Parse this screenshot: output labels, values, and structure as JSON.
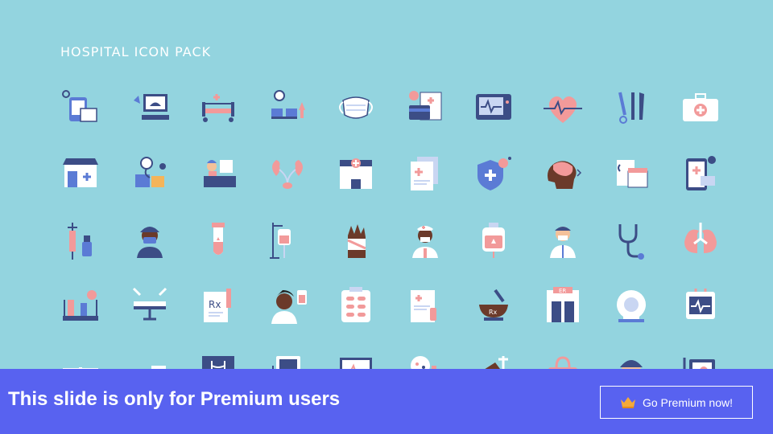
{
  "slide": {
    "title": "HOSPITAL ICON PACK"
  },
  "icons": [
    "lab-phone-icon",
    "ultrasound-machine-icon",
    "hospital-bed-icon",
    "waiting-room-icon",
    "face-mask-icon",
    "medical-bill-icon",
    "vital-monitor-icon",
    "heart-pulse-icon",
    "surgical-tools-icon",
    "first-aid-kit-icon",
    "pharmacy-store-icon",
    "blood-pressure-icon",
    "reception-desk-icon",
    "kidney-icon",
    "hospital-building-icon",
    "medical-documents-icon",
    "virus-shield-icon",
    "brain-icon",
    "medical-records-icon",
    "mobile-health-icon",
    "vaccine-syringe-icon",
    "surgeon-icon",
    "test-tube-icon",
    "iv-drip-icon",
    "bandaged-hand-icon",
    "nurse-icon",
    "blood-bag-icon",
    "doctor-icon",
    "stethoscope-icon",
    "lungs-icon",
    "lab-equipment-icon",
    "operating-table-icon",
    "prescription-icon",
    "patient-iv-icon",
    "pill-blister-icon",
    "medical-report-icon",
    "mortar-pestle-icon",
    "emergency-room-icon",
    "mri-scanner-icon",
    "monitor-device-icon",
    "helicopter-icon",
    "ambulance-icon",
    "xray-icon",
    "ecg-device-icon",
    "ecg-screen-icon",
    "petri-dish-icon",
    "crutch-icon",
    "medical-bag-icon",
    "surgeon-mask-icon",
    "defibrillator-icon"
  ],
  "banner": {
    "text": "This slide is only for Premium users",
    "button_label": "Go Premium now!",
    "button_icon": "crown-icon"
  },
  "colors": {
    "background": "#93d4df",
    "banner": "#5862f0",
    "navy": "#3c4d86",
    "blue": "#5b7bd5",
    "pink": "#f29a9a",
    "white": "#ffffff",
    "skin": "#6b3a2a",
    "gold": "#f4a93a"
  }
}
